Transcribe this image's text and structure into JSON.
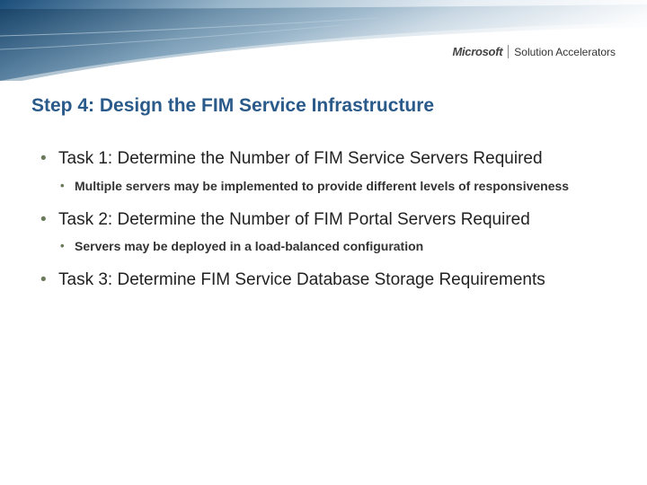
{
  "brand": {
    "logo": "Microsoft",
    "product": "Solution Accelerators"
  },
  "title": "Step 4: Design the FIM Service Infrastructure",
  "bullets": [
    {
      "text": "Task 1: Determine the Number of FIM Service Servers Required",
      "sub": [
        "Multiple servers may be implemented to provide different levels of responsiveness"
      ]
    },
    {
      "text": "Task 2: Determine the Number of FIM Portal Servers Required",
      "sub": [
        "Servers may be deployed in a load-balanced configuration"
      ]
    },
    {
      "text": "Task 3: Determine FIM Service Database Storage Requirements",
      "sub": []
    }
  ]
}
